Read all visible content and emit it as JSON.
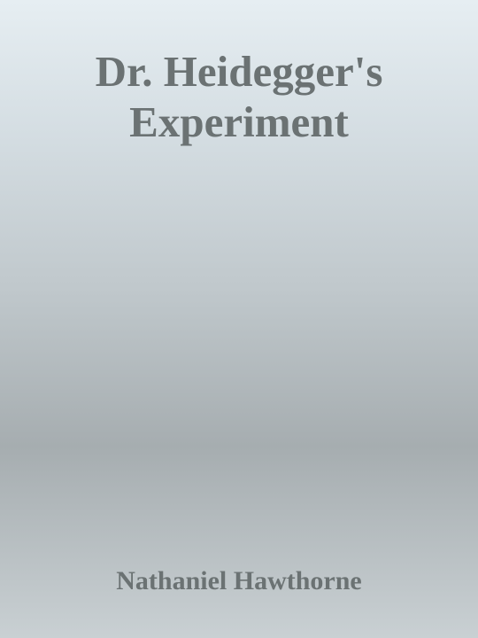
{
  "book": {
    "title_line_1": "Dr. Heidegger's",
    "title_line_2": "Experiment",
    "author": "Nathaniel Hawthorne"
  }
}
